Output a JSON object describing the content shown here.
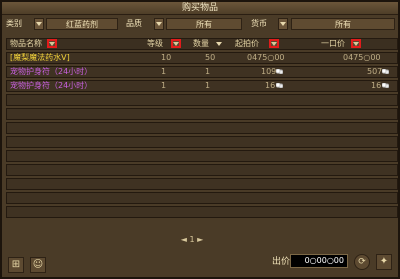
{
  "window": {
    "title": "购买物品"
  },
  "filters": {
    "type_label": "类别",
    "type_value": "红蓝药剂",
    "quality_label": "品质",
    "quality_value": "所有",
    "currency_label": "货币",
    "currency_value": "所有"
  },
  "columns": [
    {
      "label": "物品名称"
    },
    {
      "label": "等级"
    },
    {
      "label": "数量"
    },
    {
      "label": "起拍价"
    },
    {
      "label": "一口价"
    }
  ],
  "rows": [
    {
      "name": "[魔梨魔法药水Ⅴ]",
      "level": "10",
      "qty": "50",
      "start": "0475○00",
      "buyout": "0475○00",
      "color": "yellow"
    },
    {
      "name": "宠物护身符（24小时）",
      "level": "1",
      "qty": "1",
      "start": "109",
      "buyout": "507",
      "color": "purple"
    },
    {
      "name": "宠物护身符（24小时）",
      "level": "1",
      "qty": "1",
      "start": "16",
      "buyout": "16",
      "color": "purple"
    }
  ],
  "pager": {
    "text": "1"
  },
  "footer": {
    "price_label": "出价:",
    "price_value": "0○00○00"
  },
  "icons": [
    "sort-arrow-icon",
    "silver-coin-icon",
    "refresh-icon",
    "settings-icon"
  ]
}
